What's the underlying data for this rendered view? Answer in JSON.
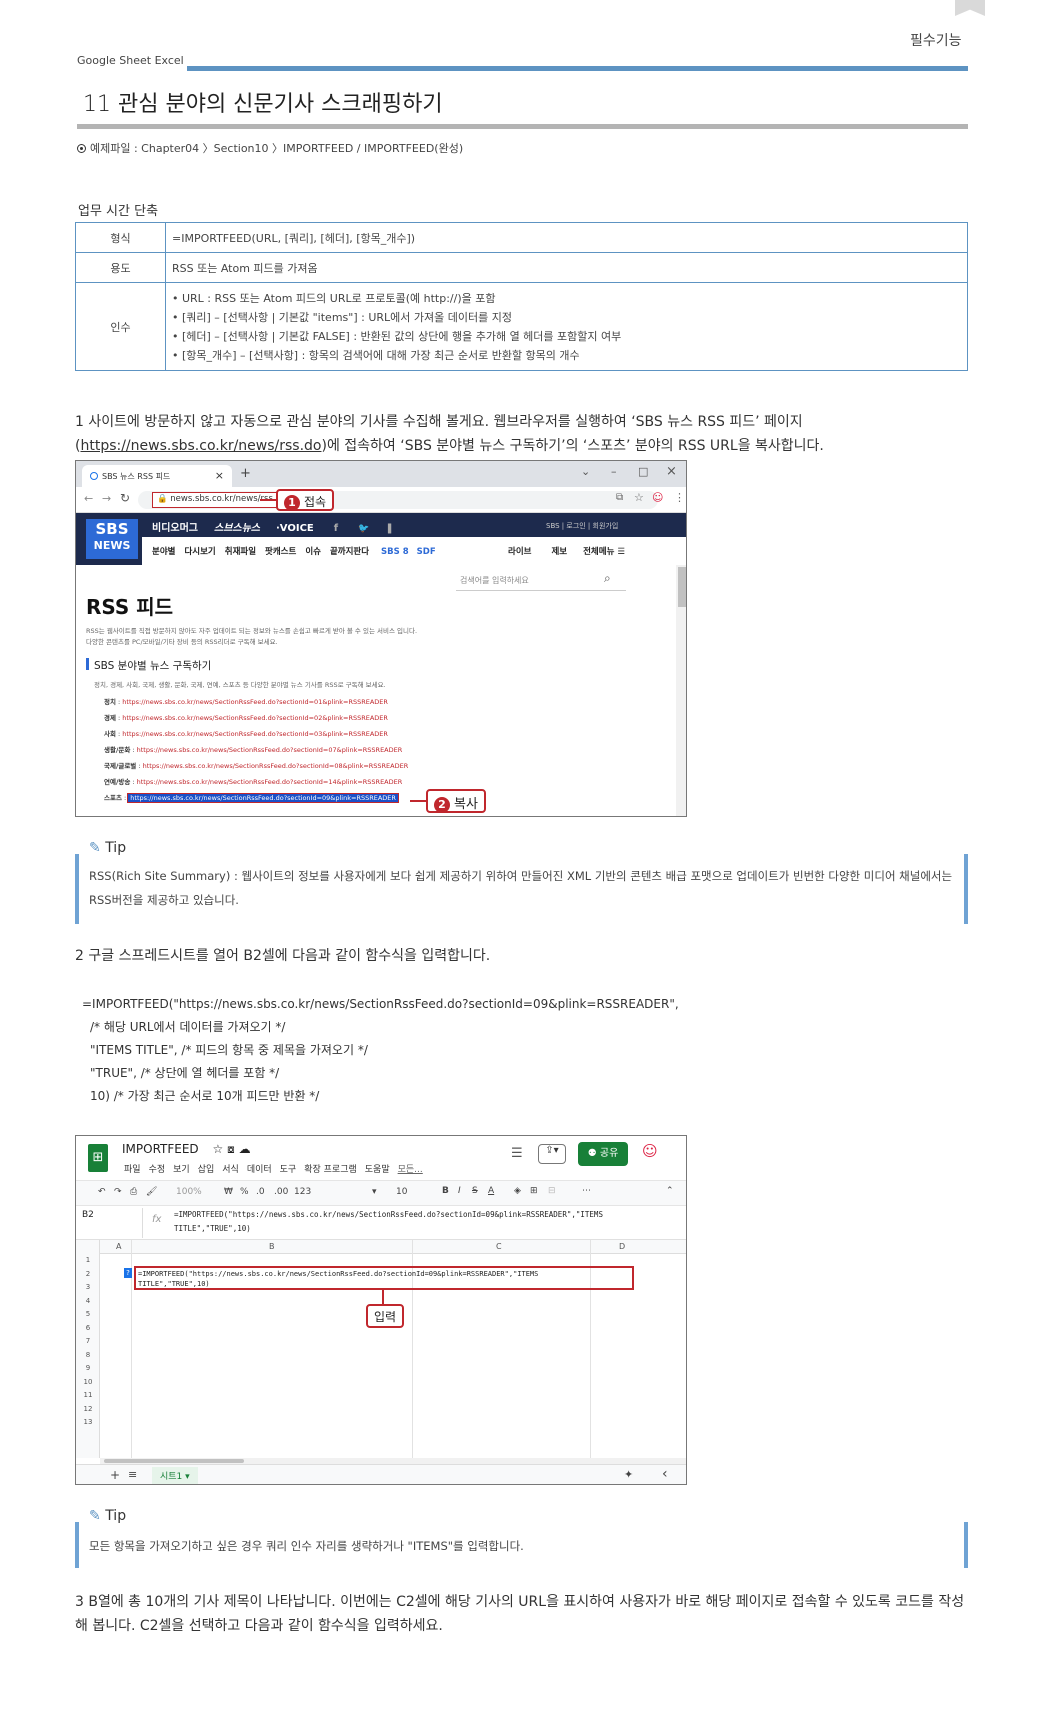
{
  "header": {
    "section_label": "필수기능",
    "breadcrumb": "Google Sheet  Excel",
    "chapter_title": "11 관심 분야의 신문기사 스크래핑하기",
    "example_file": "예제파일 : Chapter04 〉Section10 〉IMPORTFEED / IMPORTFEED(완성)"
  },
  "function_table": {
    "title": "업무 시간 단축",
    "rows": [
      {
        "key": "형식",
        "lines": [
          "=IMPORTFEED(URL, [쿼리], [헤더], [항목_개수])"
        ]
      },
      {
        "key": "용도",
        "lines": [
          "RSS 또는 Atom 피드를 가져옴"
        ]
      },
      {
        "key": "인수",
        "lines": [
          "• URL : RSS 또는 Atom 피드의 URL로 프로토콜(예 http://)을 포함",
          "• [쿼리] – [선택사항 | 기본값 \"items\"] : URL에서 가져올 데이터를 지정",
          "• [헤더] – [선택사항 | 기본값 FALSE] : 반환된 값의 상단에 행을 추가해 열 헤더를 포함할지 여부",
          "• [항목_개수] – [선택사항] : 항목의 검색어에 대해 가장 최근 순서로 반환할 항목의 개수"
        ]
      }
    ]
  },
  "step1": {
    "text_a": "1 사이트에 방문하지 않고 자동으로 관심 분야의 기사를 수집해 볼게요. 웹브라우저를 실행하여 ‘SBS 뉴스 RSS 피드’ 페이지(",
    "link": "https://news.sbs.co.kr/news/rss.do",
    "text_b": ")에 접속하여 ‘SBS 분야별 뉴스 구독하기’의 ‘스포츠’ 분야의 RSS URL을 복사합니다."
  },
  "browser": {
    "tab_title": "SBS 뉴스 RSS 피드",
    "tab_close": "×",
    "new_tab": "+",
    "window_controls": [
      "⌄",
      "–",
      "□",
      "×"
    ],
    "url": "news.sbs.co.kr/news/rss.do",
    "callout1_num": "1",
    "callout1": "접속",
    "sbs_logo_top": "SBS",
    "sbs_logo_bottom": "NEWS",
    "top_nav": [
      "비디오머그",
      "스브스뉴스",
      "·VOICE",
      "f",
      "🐦",
      "❚"
    ],
    "top_right": "SBS | 로그인 | 회원가입",
    "main_nav": [
      "분야별",
      "다시보기",
      "취재파일",
      "팟캐스트",
      "이슈",
      "끝까지판다"
    ],
    "nav_right": [
      "라이브",
      "제보",
      "전체메뉴"
    ],
    "search_placeholder": "검색어를 입력하세요",
    "page_title": "RSS 피드",
    "desc1": "RSS는 웹사이트를 직접 방문하지 않아도 자주 업데이트 되는 정보와 뉴스를 손쉽고 빠르게 받아 볼 수 있는 서비스 입니다.",
    "desc2": "다양한 콘텐츠를 PC/모바일/기타 장비 등의 RSS리더로 구독해 보세요.",
    "sub_title": "SBS 분야별 뉴스 구독하기",
    "sub_desc": "정치, 경제, 사회, 국제, 생활, 문화, 국제, 연예, 스포츠 등 다양한 분야별 뉴스 기사를 RSS로 구독해 보세요.",
    "feeds": [
      {
        "label": "정치",
        "url": "https://news.sbs.co.kr/news/SectionRssFeed.do?sectionId=01&plink=RSSREADER"
      },
      {
        "label": "경제",
        "url": "https://news.sbs.co.kr/news/SectionRssFeed.do?sectionId=02&plink=RSSREADER"
      },
      {
        "label": "사회",
        "url": "https://news.sbs.co.kr/news/SectionRssFeed.do?sectionId=03&plink=RSSREADER"
      },
      {
        "label": "생활/문화",
        "url": "https://news.sbs.co.kr/news/SectionRssFeed.do?sectionId=07&plink=RSSREADER"
      },
      {
        "label": "국제/글로벌",
        "url": "https://news.sbs.co.kr/news/SectionRssFeed.do?sectionId=08&plink=RSSREADER"
      },
      {
        "label": "연예/방송",
        "url": "https://news.sbs.co.kr/news/SectionRssFeed.do?sectionId=14&plink=RSSREADER"
      },
      {
        "label": "스포츠",
        "url": "https://news.sbs.co.kr/news/SectionRssFeed.do?sectionId=09&plink=RSSREADER"
      }
    ],
    "callout2_num": "2",
    "callout2": "복사"
  },
  "tip1": {
    "head": "Tip",
    "text": "RSS(Rich Site Summary) : 웹사이트의 정보를 사용자에게 보다 쉽게 제공하기 위하여 만들어진 XML 기반의 콘텐츠 배급 포맷으로 업데이트가 빈번한 다양한 미디어 채널에서는 RSS버전을 제공하고 있습니다."
  },
  "step2": {
    "text": "2 구글 스프레드시트를 열어 B2셀에 다음과 같이 함수식을 입력합니다."
  },
  "code_lines": [
    "=IMPORTFEED(\"https://news.sbs.co.kr/news/SectionRssFeed.do?sectionId=09&plink=RSSREADER\",",
    "/* 해당 URL에서 데이터를 가져오기 */",
    "\"ITEMS TITLE\", /* 피드의 항목 중 제목을 가져오기 */",
    "\"TRUE\", /* 상단에 열 헤더를 포함 */",
    "10) /* 가장 최근 순서로 10개 피드만 반환 */"
  ],
  "sheet": {
    "doc_title": "IMPORTFEED",
    "menus": [
      "파일",
      "수정",
      "보기",
      "삽입",
      "서식",
      "데이터",
      "도구",
      "확장 프로그램",
      "도움말",
      "모든..."
    ],
    "share": "공유",
    "zoom": "100%",
    "fmt": [
      "₩",
      "%",
      ".0",
      ".00",
      "123"
    ],
    "font_size": "10",
    "cell_ref": "B2",
    "fx": "fx",
    "formula_line1": "=IMPORTFEED(\"https://news.sbs.co.kr/news/SectionRssFeed.do?sectionId=09&plink=RSSREADER\",\"ITEMS",
    "formula_line2": "TITLE\",\"TRUE\",10)",
    "columns": [
      "A",
      "B",
      "C",
      "D"
    ],
    "rows": [
      "1",
      "2",
      "3",
      "4",
      "5",
      "6",
      "7",
      "8",
      "9",
      "10",
      "11",
      "12",
      "13"
    ],
    "cell_line1": "=IMPORTFEED(\"https://news.sbs.co.kr/news/SectionRssFeed.do?sectionId=09&plink=RSSREADER\",\"ITEMS",
    "cell_line2": "TITLE\",\"TRUE\",10)",
    "cell_marker": "?",
    "callout": "입력",
    "sheet_tab": "시트1",
    "add": "+",
    "list": "≡",
    "collapse": "‹"
  },
  "tip2": {
    "head": "Tip",
    "text": "모든 항목을 가져오기하고 싶은 경우 쿼리 인수 자리를 생략하거나 \"ITEMS\"를 입력합니다."
  },
  "step3": {
    "text": "3 B열에 총 10개의 기사 제목이 나타납니다. 이번에는 C2셀에 해당 기사의 URL을 표시하여 사용자가 바로 해당 페이지로 접속할 수 있도록 코드를 작성해 봅니다. C2셀을 선택하고 다음과 같이 함수식을 입력하세요."
  },
  "colors": {
    "accent_blue": "#5d93c2",
    "callout_red": "#c0272d",
    "sbs_navy": "#1d2a4d",
    "sheets_green": "#188038"
  }
}
